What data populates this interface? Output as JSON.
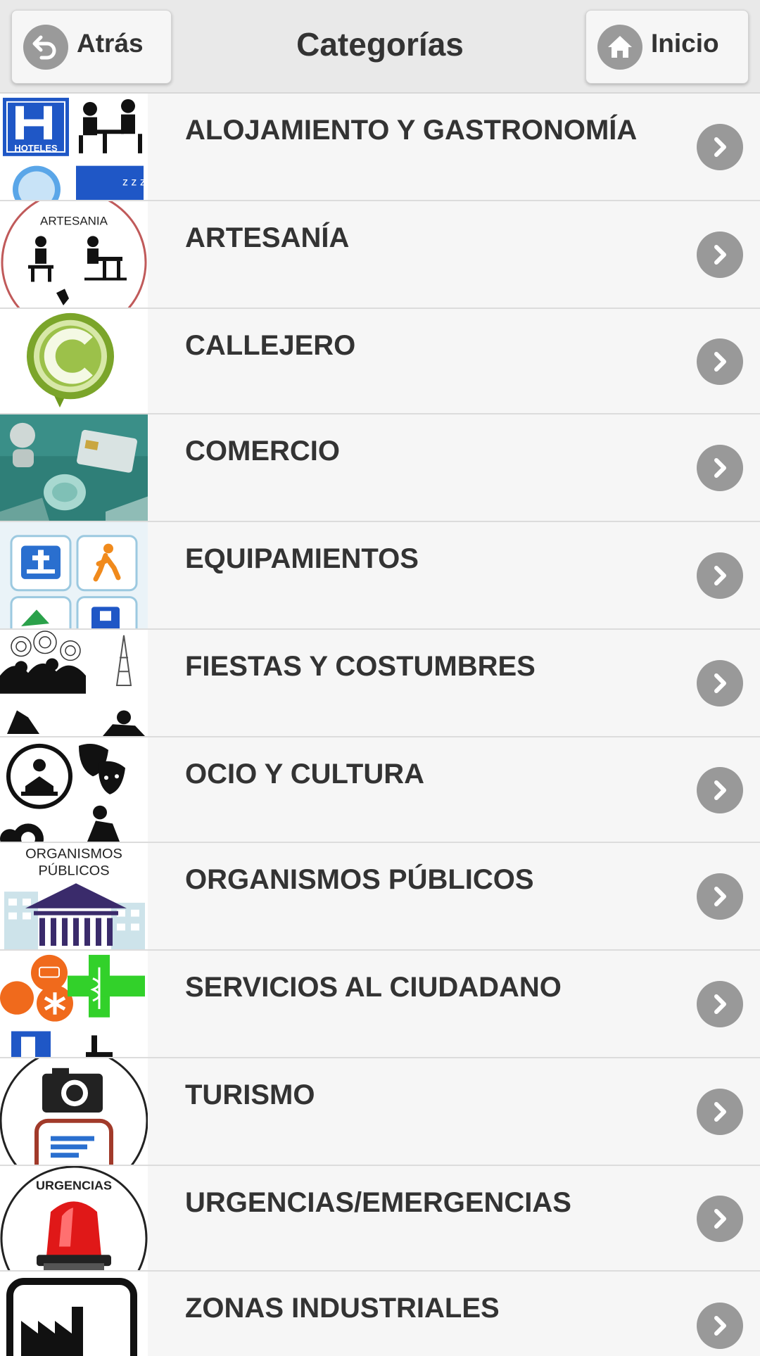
{
  "header": {
    "title": "Categorías",
    "back_label": "Atrás",
    "home_label": "Inicio"
  },
  "thumb_text": {
    "hoteles": "HOTELES",
    "artesania": "ARTESANIA",
    "organismos_1": "ORGANISMOS",
    "organismos_2": "PÚBLICOS",
    "urgencias": "URGENCIAS"
  },
  "categories": [
    {
      "label": "ALOJAMIENTO Y GASTRONOMÍA",
      "icon": "hotel-restaurant-icon"
    },
    {
      "label": "ARTESANÍA",
      "icon": "crafts-icon"
    },
    {
      "label": "CALLEJERO",
      "icon": "street-map-pin-icon"
    },
    {
      "label": "COMERCIO",
      "icon": "commerce-icon"
    },
    {
      "label": "EQUIPAMIENTOS",
      "icon": "facilities-icon"
    },
    {
      "label": "FIESTAS Y COSTUMBRES",
      "icon": "festivals-icon"
    },
    {
      "label": "OCIO Y CULTURA",
      "icon": "leisure-culture-icon"
    },
    {
      "label": "ORGANISMOS PÚBLICOS",
      "icon": "public-bodies-icon"
    },
    {
      "label": "SERVICIOS AL CIUDADANO",
      "icon": "citizen-services-icon"
    },
    {
      "label": "TURISMO",
      "icon": "tourism-icon"
    },
    {
      "label": "URGENCIAS/EMERGENCIAS",
      "icon": "emergency-siren-icon"
    },
    {
      "label": "ZONAS INDUSTRIALES",
      "icon": "industrial-zone-icon"
    }
  ],
  "colors": {
    "header_bg": "#e9e9e9",
    "row_bg": "#f6f6f6",
    "text": "#333333",
    "chevron": "#999999"
  }
}
